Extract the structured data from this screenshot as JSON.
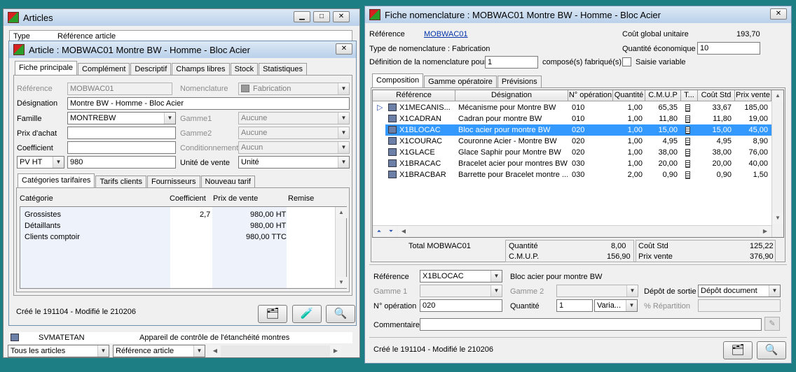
{
  "articles": {
    "title": "Articles",
    "col_type": "Type",
    "col_ref": "Référence article",
    "row_ref": "SVMATETAN",
    "row_desc": "Appareil de contrôle de l'étanchéité montres",
    "filter1": "Tous les articles",
    "filter2": "Référence article"
  },
  "article": {
    "title": "Article : MOBWAC01 Montre BW - Homme - Bloc Acier",
    "tabs": [
      "Fiche principale",
      "Complément",
      "Descriptif",
      "Champs libres",
      "Stock",
      "Statistiques"
    ],
    "reference_label": "Référence",
    "reference": "MOBWAC01",
    "nomenclature_label": "Nomenclature",
    "nomenclature": "Fabrication",
    "designation_label": "Désignation",
    "designation": "Montre BW - Homme - Bloc Acier",
    "famille_label": "Famille",
    "famille": "MONTREBW",
    "gamme1_label": "Gamme1",
    "gamme1": "Aucune",
    "prix_achat_label": "Prix d'achat",
    "gamme2_label": "Gamme2",
    "gamme2": "Aucune",
    "coefficient_label": "Coefficient",
    "conditionnement_label": "Conditionnement",
    "conditionnement": "Aucun",
    "pv_type": "PV HT",
    "pv": "980",
    "unite_label": "Unité de vente",
    "unite": "Unité",
    "subtabs": [
      "Catégories tarifaires",
      "Tarifs clients",
      "Fournisseurs",
      "Nouveau tarif"
    ],
    "cat_headers": [
      "Catégorie",
      "Coefficient",
      "Prix de vente",
      "Remise"
    ],
    "categories": [
      {
        "name": "Grossistes",
        "coef": "2,7",
        "prix": "980,00 HT"
      },
      {
        "name": "Détaillants",
        "coef": "",
        "prix": "980,00 HT"
      },
      {
        "name": "Clients comptoir",
        "coef": "",
        "prix": "980,00 TTC"
      }
    ],
    "footer": "Créé le 191104 - Modifié le 210206"
  },
  "nomen": {
    "title": "Fiche nomenclature : MOBWAC01 Montre BW - Homme - Bloc Acier",
    "reference_label": "Référence",
    "reference": "MOBWAC01",
    "cout_label": "Coût global unitaire",
    "cout": "193,70",
    "type_label": "Type de nomenclature : Fabrication",
    "qte_eco_label": "Quantité économique",
    "qte_eco": "10",
    "def_label": "Définition de la nomenclature pour",
    "def_val": "1",
    "def_suffix": "composé(s) fabriqué(s)",
    "saisie_label": "Saisie variable",
    "tabs": [
      "Composition",
      "Gamme opératoire",
      "Prévisions"
    ],
    "headers": [
      "Référence",
      "Désignation",
      "N° opération",
      "Quantité",
      "C.M.U.P",
      "T...",
      "Coût Std",
      "Prix vente"
    ],
    "rows": [
      {
        "ref": "X1MECANIS...",
        "des": "Mécanisme pour Montre BW",
        "op": "010",
        "qte": "1,00",
        "cmup": "65,35",
        "std": "33,67",
        "pv": "185,00"
      },
      {
        "ref": "X1CADRAN",
        "des": "Cadran pour montre BW",
        "op": "010",
        "qte": "1,00",
        "cmup": "11,80",
        "std": "11,80",
        "pv": "19,00"
      },
      {
        "ref": "X1BLOCAC",
        "des": "Bloc acier pour montre BW",
        "op": "020",
        "qte": "1,00",
        "cmup": "15,00",
        "std": "15,00",
        "pv": "45,00"
      },
      {
        "ref": "X1COURAC",
        "des": "Couronne Acier - Montre BW",
        "op": "020",
        "qte": "1,00",
        "cmup": "4,95",
        "std": "4,95",
        "pv": "8,90"
      },
      {
        "ref": "X1GLACE",
        "des": "Glace Saphir pour Montre BW",
        "op": "020",
        "qte": "1,00",
        "cmup": "38,00",
        "std": "38,00",
        "pv": "76,00"
      },
      {
        "ref": "X1BRACAC",
        "des": "Bracelet acier pour montres BW",
        "op": "030",
        "qte": "1,00",
        "cmup": "20,00",
        "std": "20,00",
        "pv": "40,00"
      },
      {
        "ref": "X1BRACBAR",
        "des": "Barrette pour Bracelet montre ...",
        "op": "030",
        "qte": "2,00",
        "cmup": "0,90",
        "std": "0,90",
        "pv": "1,50"
      }
    ],
    "total_label": "Total MOBWAC01",
    "tot_qte_label": "Quantité",
    "tot_qte": "8,00",
    "tot_cmup_label": "C.M.U.P.",
    "tot_cmup": "156,90",
    "tot_std_label": "Coût Std",
    "tot_std": "125,22",
    "tot_pv_label": "Prix vente",
    "tot_pv": "376,90",
    "d_ref_label": "Référence",
    "d_ref": "X1BLOCAC",
    "d_ref_des": "Bloc acier pour montre BW",
    "d_g1_label": "Gamme 1",
    "d_g2_label": "Gamme 2",
    "d_depot_label": "Dépôt de sortie",
    "d_depot": "Dépôt document",
    "d_op_label": "N° opération",
    "d_op": "020",
    "d_qte_label": "Quantité",
    "d_qte": "1",
    "d_var": "Varia...",
    "d_rep_label": "% Répartition",
    "d_comment_label": "Commentaire",
    "footer": "Créé le 191104 - Modifié le 210206"
  }
}
